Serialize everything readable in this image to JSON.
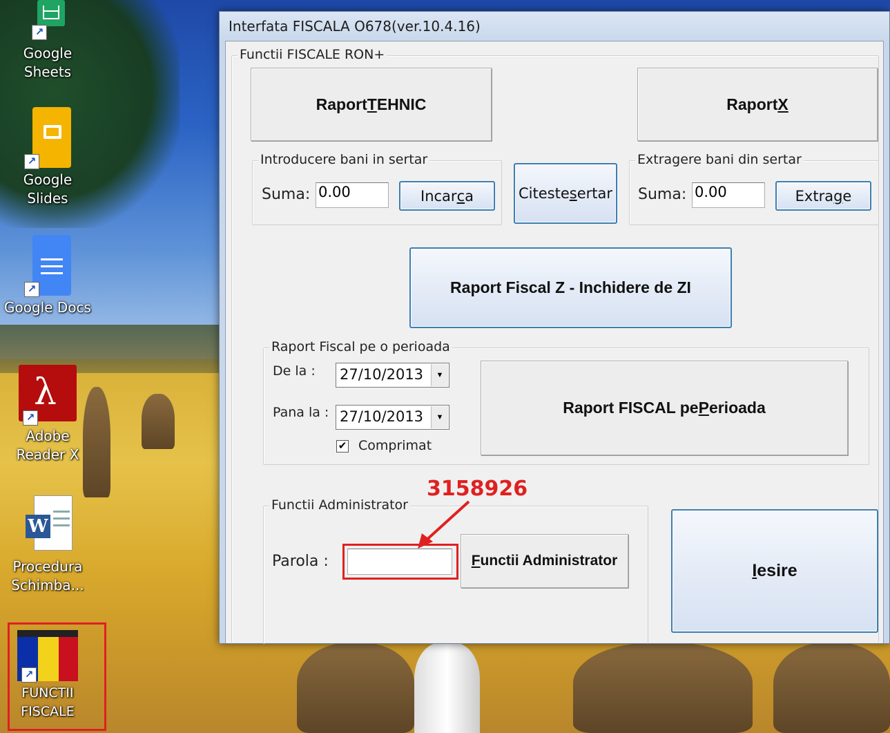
{
  "desktop": {
    "icons": [
      {
        "label": "Google Sheets"
      },
      {
        "label": "Google Slides"
      },
      {
        "label": "Google Docs"
      },
      {
        "label": "Adobe Reader X"
      },
      {
        "label": "Procedura Schimba..."
      },
      {
        "label": "FUNCTII FISCALE"
      }
    ]
  },
  "window": {
    "title": "Interfata FISCALA  O678(ver.10.4.16)",
    "main_group": "Functii FISCALE RON+",
    "raport_tehnic": {
      "pre": "Raport ",
      "u": "T",
      "post": "EHNIC"
    },
    "raport_x": {
      "pre": "Raport ",
      "u": "X"
    },
    "intro_group": "Introducere bani in sertar",
    "intro_suma_label": "Suma:",
    "intro_suma_value": "0.00",
    "incarca": {
      "pre": "Incar",
      "u": "c",
      "post": "a"
    },
    "citeste": {
      "pre": "Citeste ",
      "u": "s",
      "post": "ertar"
    },
    "extr_group": "Extragere bani din sertar",
    "extr_suma_label": "Suma:",
    "extr_suma_value": "0.00",
    "extrage": {
      "pre": "Extra",
      "u": "g",
      "post": "e"
    },
    "raport_z": "Raport Fiscal Z - Inchidere de ZI",
    "perioada_group": "Raport Fiscal pe o perioada",
    "de_la_label": "De la :",
    "de_la_value": "27/10/2013",
    "pana_la_label": "Pana la :",
    "pana_la_value": "27/10/2013",
    "comprimat_label": "Comprimat",
    "comprimat_checked": true,
    "raport_perioada": {
      "pre": "Raport FISCAL pe ",
      "u": "P",
      "post": "erioada"
    },
    "admin_group": "Functii Administrator",
    "parola_label": "Parola :",
    "parola_value": "",
    "functii_admin": {
      "u": "F",
      "post": "unctii Administrator"
    },
    "iesire": {
      "u": "I",
      "post": "esire"
    }
  },
  "annotation": {
    "password_hint": "3158926",
    "color": "#e02020"
  }
}
